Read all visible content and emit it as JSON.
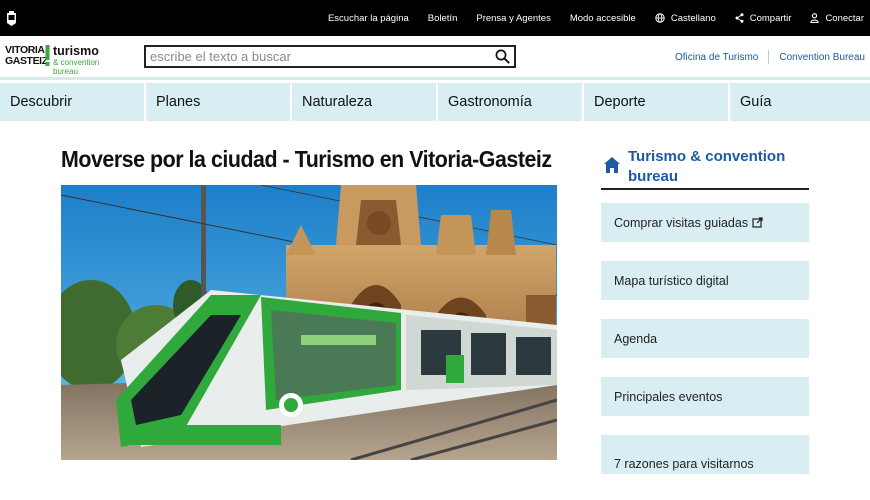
{
  "topbar": {
    "links": [
      {
        "label": "Escuchar la página",
        "icon": ""
      },
      {
        "label": "Boletín",
        "icon": ""
      },
      {
        "label": "Prensa y Agentes",
        "icon": ""
      },
      {
        "label": "Modo accesible",
        "icon": ""
      },
      {
        "label": "Castellano",
        "icon": "globe-icon"
      },
      {
        "label": "Compartir",
        "icon": "share-icon"
      },
      {
        "label": "Conectar",
        "icon": "user-icon"
      }
    ]
  },
  "logo": {
    "line1": "VITORIA",
    "line2": "GASTEIZ",
    "turismo": "turismo",
    "convention": "& convention bureau"
  },
  "search": {
    "placeholder": "escribe el texto a buscar"
  },
  "header_links": {
    "oficina": "Oficina de Turismo",
    "convention": "Convention Bureau"
  },
  "nav": {
    "items": [
      "Descubrir",
      "Planes",
      "Naturaleza",
      "Gastronomía",
      "Deporte",
      "Guía"
    ]
  },
  "main": {
    "title": "Moverse por la ciudad - Turismo en Vitoria-Gasteiz"
  },
  "sidebar": {
    "heading": "Turismo & convention bureau",
    "items": [
      {
        "label": "Comprar visitas guiadas",
        "external": true
      },
      {
        "label": "Mapa turístico digital"
      },
      {
        "label": "Agenda"
      },
      {
        "label": "Principales eventos"
      },
      {
        "label": "7 razones para visitarnos"
      }
    ]
  },
  "colors": {
    "accent_blue": "#1a5aa6",
    "nav_bg": "#d8eef2",
    "brand_green": "#3aa83a"
  }
}
